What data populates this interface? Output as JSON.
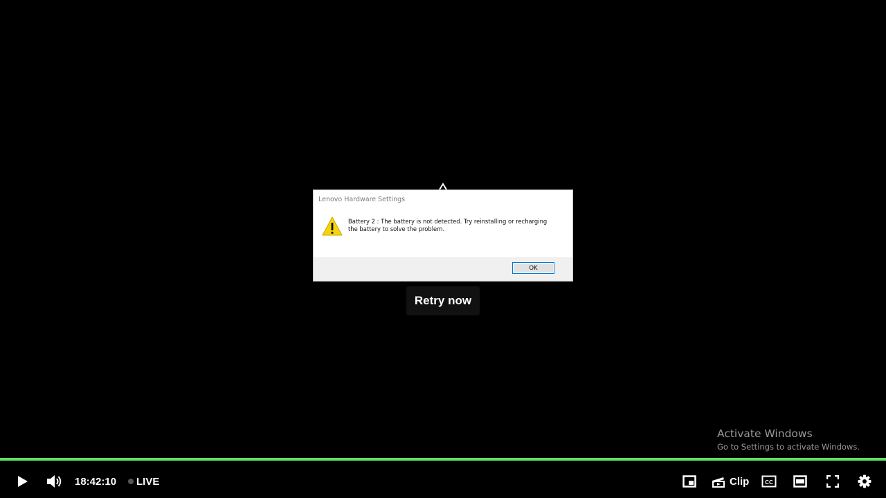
{
  "dialog": {
    "title": "Lenovo Hardware Settings",
    "message": "Battery 2 : The battery is not detected. Try reinstalling or recharging the battery to solve the problem.",
    "ok_label": "OK",
    "icon": "warning-icon"
  },
  "retry": {
    "label": "Retry now"
  },
  "watermark": {
    "title": "Activate Windows",
    "subtitle": "Go to Settings to activate Windows."
  },
  "progress": {
    "fraction": 1.0,
    "color": "#5ee25e"
  },
  "controls": {
    "time": "18:42:10",
    "live_label": "LIVE",
    "clip_label": "Clip",
    "icons": [
      "play-icon",
      "volume-icon",
      "miniplayer-icon",
      "clip-icon",
      "captions-icon",
      "theater-icon",
      "fullscreen-icon",
      "settings-icon"
    ]
  }
}
